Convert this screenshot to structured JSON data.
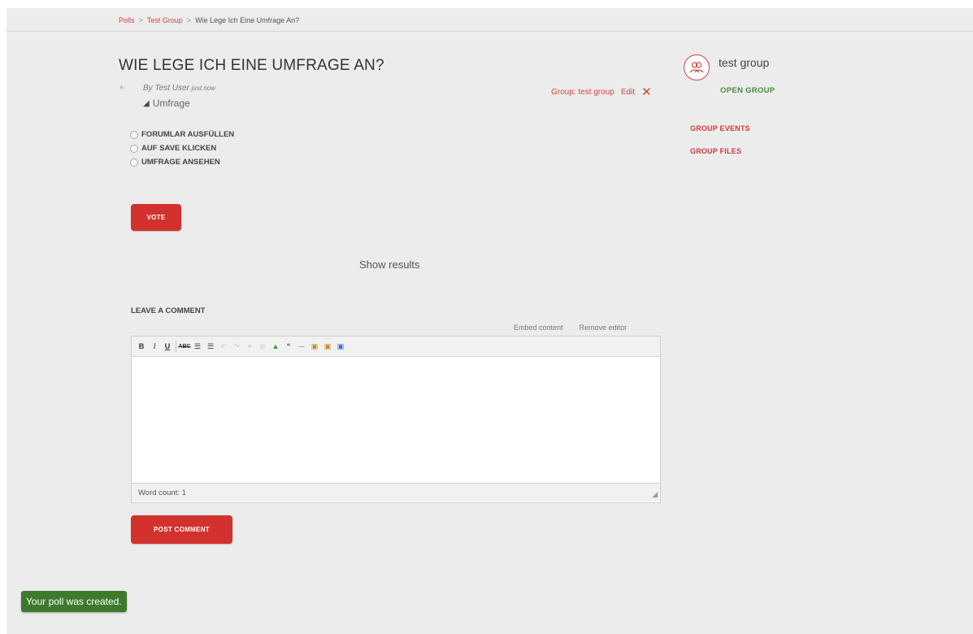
{
  "breadcrumb": {
    "items": [
      "Polls",
      "Test Group",
      "Wie Lege Ich Eine Umfrage An?"
    ],
    "separator": ">"
  },
  "post": {
    "title": "WIE LEGE ICH EINE UMFRAGE AN?",
    "author": "By Test User",
    "time": "just now",
    "tag": "Umfrage",
    "group_label": "Group: test group",
    "edit_label": "Edit",
    "delete_glyph": "✕"
  },
  "poll": {
    "options": [
      "FORUMLAR AUSFÜLLEN",
      "AUF SAVE KLICKEN",
      "UMFRAGE ANSEHEN"
    ],
    "vote_label": "VOTE",
    "show_results": "Show results"
  },
  "comment": {
    "heading": "LEAVE A COMMENT",
    "embed_link": "Embed content",
    "remove_editor": "Remove editor",
    "word_count": "Word count: 1",
    "submit_label": "POST COMMENT",
    "toolbar": [
      "bold",
      "italic",
      "underline",
      "strikethrough",
      "bullet-list",
      "numbered-list",
      "undo",
      "redo",
      "link",
      "unlink",
      "image",
      "blockquote",
      "horizontal-rule",
      "paste",
      "paste-text",
      "paste-word"
    ]
  },
  "sidebar": {
    "group_name": "test group",
    "membership": "OPEN GROUP",
    "links": [
      "GROUP EVENTS",
      "GROUP FILES"
    ]
  },
  "notification": {
    "message": "Your poll was created."
  },
  "colors": {
    "accent": "#d3312e",
    "success": "#3d7a2c",
    "open_group": "#4a8a3e",
    "background": "#ececec"
  }
}
